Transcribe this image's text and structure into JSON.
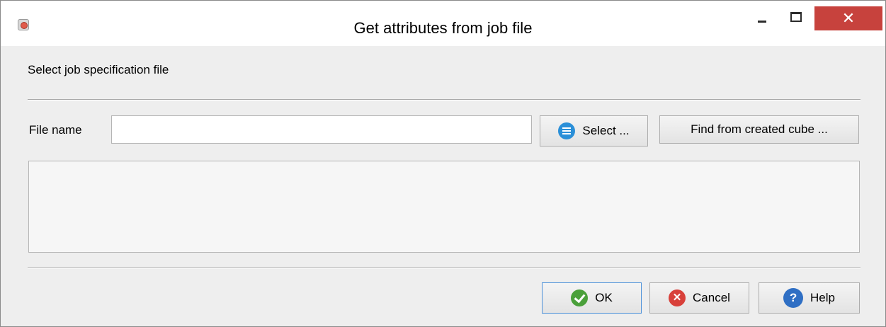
{
  "window": {
    "title": "Get attributes from job file",
    "close_glyph": "✕",
    "cancel_glyph": "✕",
    "help_glyph": "?"
  },
  "section": {
    "label": "Select job specification file"
  },
  "file": {
    "label": "File name",
    "value": "",
    "placeholder": ""
  },
  "buttons": {
    "select": "Select ...",
    "find": "Find from created cube ...",
    "ok": "OK",
    "cancel": "Cancel",
    "help": "Help"
  },
  "icons": {
    "app": "app-icon",
    "select": "list-icon",
    "ok": "check-icon",
    "cancel": "cancel-icon",
    "help": "help-icon"
  },
  "colors": {
    "close_button": "#c7423d",
    "ok_border": "#4a90d9",
    "list_icon": "#2a8fd8",
    "check_icon": "#4aa03a",
    "cancel_icon": "#d8403a",
    "help_icon": "#2f6fc4"
  }
}
